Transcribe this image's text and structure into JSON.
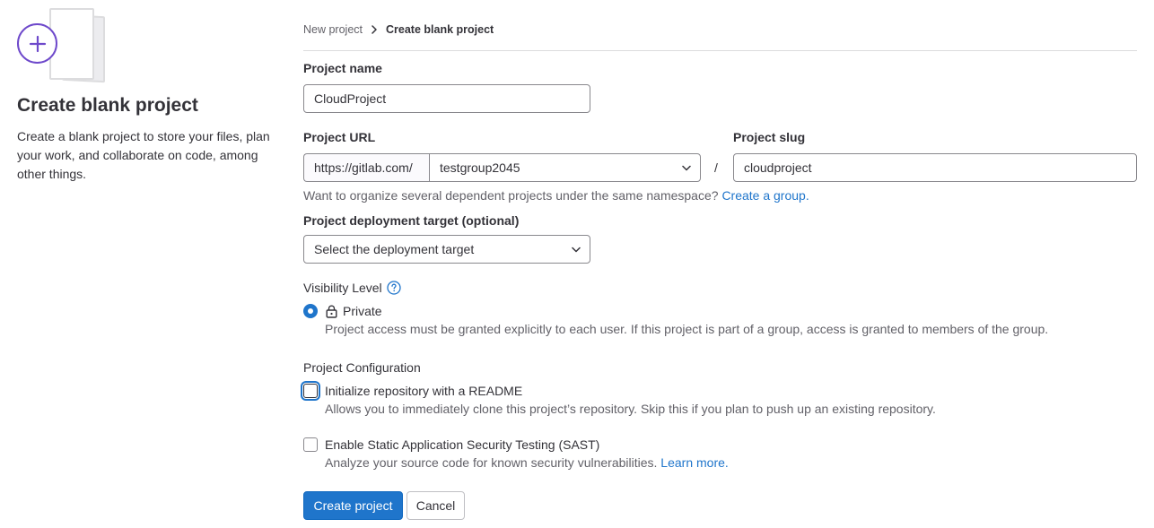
{
  "sidebar": {
    "title": "Create blank project",
    "description": "Create a blank project to store your files, plan your work, and collaborate on code, among other things."
  },
  "breadcrumb": {
    "parent": "New project",
    "current": "Create blank project"
  },
  "project_name": {
    "label": "Project name",
    "value": "CloudProject"
  },
  "project_url": {
    "label": "Project URL",
    "prefix": "https://gitlab.com/",
    "namespace": "testgroup2045",
    "separator": "/"
  },
  "project_slug": {
    "label": "Project slug",
    "value": "cloudproject"
  },
  "namespace_help": {
    "text": "Want to organize several dependent projects under the same namespace?",
    "link": "Create a group."
  },
  "deployment_target": {
    "label": "Project deployment target (optional)",
    "placeholder": "Select the deployment target"
  },
  "visibility": {
    "label": "Visibility Level",
    "option_label": "Private",
    "option_help": "Project access must be granted explicitly to each user. If this project is part of a group, access is granted to members of the group."
  },
  "configuration": {
    "label": "Project Configuration",
    "readme_label": "Initialize repository with a README",
    "readme_help": "Allows you to immediately clone this project’s repository. Skip this if you plan to push up an existing repository.",
    "readme_checked": false,
    "sast_label": "Enable Static Application Security Testing (SAST)",
    "sast_help": "Analyze your source code for known security vulnerabilities.",
    "sast_link": "Learn more.",
    "sast_checked": false
  },
  "actions": {
    "create": "Create project",
    "cancel": "Cancel"
  },
  "colors": {
    "primary": "#1f75cb",
    "accent_purple": "#6e49cb",
    "text": "#333238",
    "muted": "#626168"
  }
}
